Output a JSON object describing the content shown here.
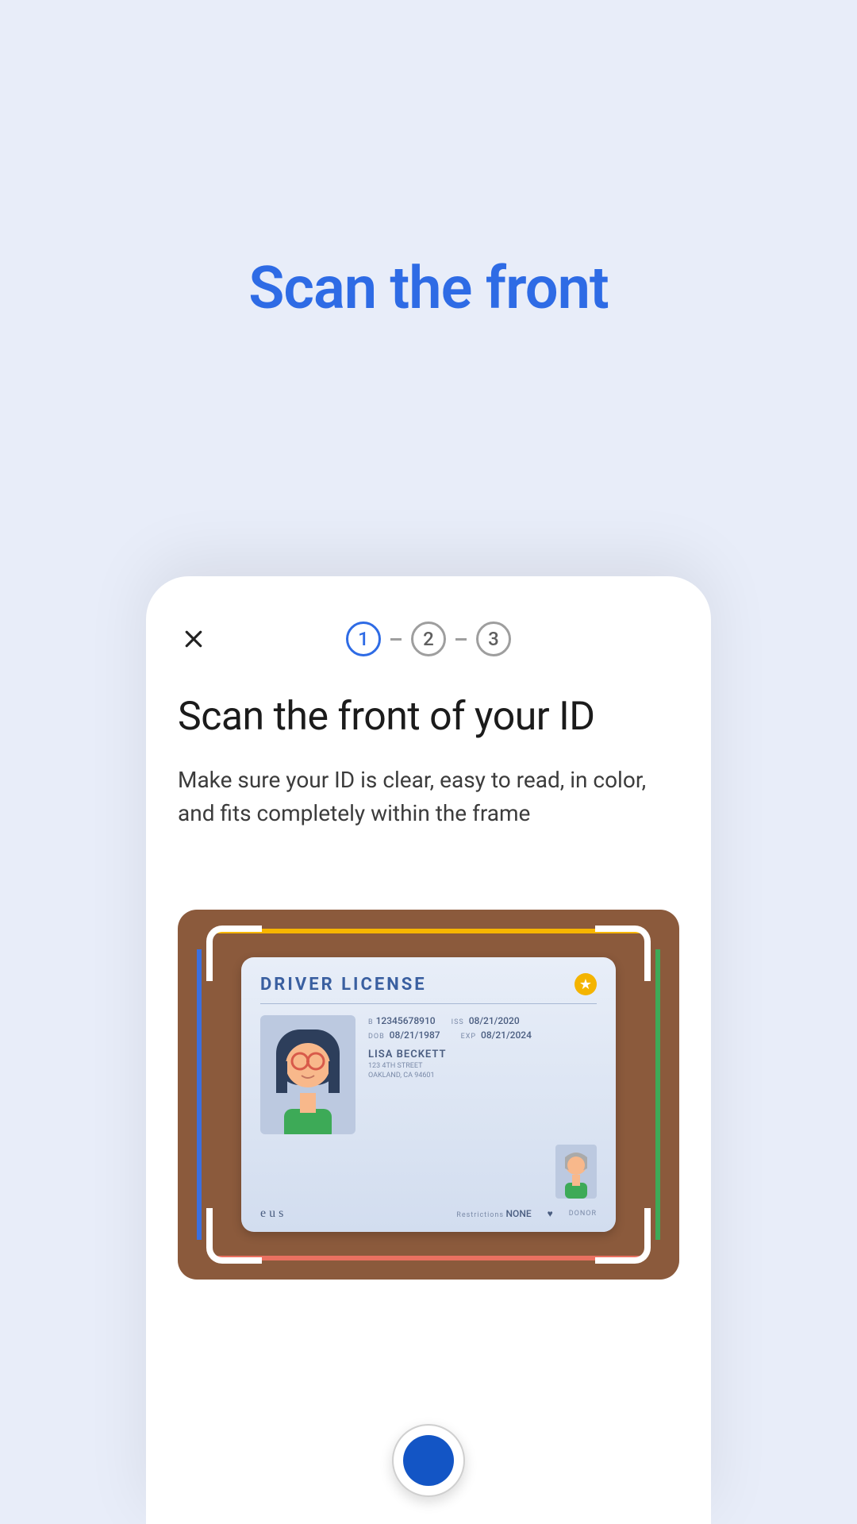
{
  "page_title": "Scan the front",
  "stepper": {
    "steps": [
      "1",
      "2",
      "3"
    ],
    "active_index": 0
  },
  "card": {
    "title": "Scan the front of your ID",
    "subtitle": "Make sure your ID is clear, easy to read, in color, and fits completely within the frame"
  },
  "license": {
    "title": "DRIVER LICENSE",
    "id_label": "B",
    "id_value": "12345678910",
    "iss_label": "ISS",
    "iss_value": "08/21/2020",
    "dob_label": "DOB",
    "dob_value": "08/21/1987",
    "exp_label": "EXP",
    "exp_value": "08/21/2024",
    "name": "LISA BECKETT",
    "address1": "123 4TH STREET",
    "address2": "OAKLAND, CA 94601",
    "signature": "e u s",
    "restrictions_label": "Restrictions",
    "restrictions_value": "NONE",
    "donor_label": "DONOR"
  }
}
